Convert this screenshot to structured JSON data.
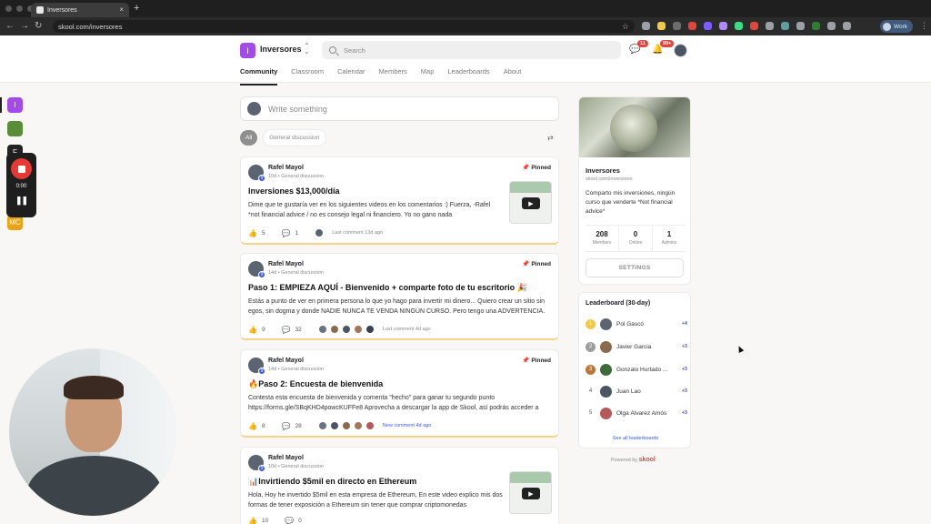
{
  "browser": {
    "tab_title": "Inversores",
    "tab_close": "×",
    "new_tab": "+",
    "back": "←",
    "forward": "→",
    "reload": "↻",
    "url": "skool.com/inversores",
    "star": "☆",
    "profile_label": "Work",
    "menu": "⋮"
  },
  "header": {
    "group_initial": "I",
    "group_name": "Inversores",
    "search_placeholder": "Search",
    "chat_badge": "11",
    "notif_badge": "99+",
    "tabs": [
      "Community",
      "Classroom",
      "Calendar",
      "Members",
      "Map",
      "Leaderboards",
      "About"
    ]
  },
  "rail": {
    "items": [
      {
        "initial": "I",
        "color": "#a24be6"
      },
      {
        "initial": "",
        "color": "#5b8c3a"
      },
      {
        "initial": "F",
        "color": "#222222"
      },
      {
        "initial": "MC",
        "color": "#e8a317"
      }
    ],
    "recorder_time": "0:00"
  },
  "composer": {
    "placeholder": "Write something"
  },
  "filters": {
    "all": "All",
    "general": "General discussion",
    "filter_icon": "⇄"
  },
  "posts": [
    {
      "author": "Rafel Mayol",
      "level": "9",
      "meta": "10d • General discussion",
      "pinned": "Pinned",
      "title": "Inversiones $13,000/día",
      "body": "Dime que te gustaría ver en los siguientes videos en los comentarios :) Fuerza, -Rafel *not financial advice / no es consejo legal ni financiero. Yo no gano nada",
      "likes": "5",
      "comments": "1",
      "last": "Last comment 13d ago"
    },
    {
      "author": "Rafel Mayol",
      "level": "9",
      "meta": "14d • General discussion",
      "pinned": "Pinned",
      "title": "Paso 1: EMPIEZA AQUÍ - Bienvenido + comparte foto de tu escritorio 🎉",
      "body": "Estás a punto de ver en primera persona lo que yo hago para invertir mi dinero... Quiero crear un sitio sin egos, sin dogma y donde NADIE NUNCA TE VENDA NINGÚN CURSO. Pero tengo una ADVERTENCIA.",
      "likes": "9",
      "comments": "32",
      "last": "Last comment 4d ago"
    },
    {
      "author": "Rafel Mayol",
      "level": "9",
      "meta": "14d • General discussion",
      "pinned": "Pinned",
      "title": "🔥Paso 2: Encuesta de bienvenida",
      "body": "Contesta esta encuesta de bienvenida y comenta \"hecho\" para ganar tu segundo punto https://forms.gle/SBqKHD4powcKUFFe8 Aprovecha a descargar la app de Skool, así podrás acceder a",
      "likes": "8",
      "comments": "28",
      "last": "New comment 4d ago"
    },
    {
      "author": "Rafel Mayol",
      "level": "9",
      "meta": "10d • General discussion",
      "pinned": "",
      "title": "📊Invirtiendo $5mil en directo en Ethereum",
      "body": "Hola, Hoy he invertido $5mil en esta empresa de Ethereum, En este video explico mis dos formas de tener exposición a Ethereum sin tener que comprar criptomonedas",
      "likes": "10",
      "comments": "0",
      "last": ""
    }
  ],
  "about": {
    "name": "Inversores",
    "url": "skool.com/inversores",
    "description": "Comparto mis inversiones, ningún curso que venderte *Not financial advice*",
    "members": "208",
    "members_label": "Members",
    "online": "0",
    "online_label": "Online",
    "admins": "1",
    "admins_label": "Admins",
    "settings_label": "SETTINGS"
  },
  "leaderboard": {
    "title": "Leaderboard (30-day)",
    "rows": [
      {
        "rank": "1",
        "name": "Pol Gascó",
        "points": "+4"
      },
      {
        "rank": "2",
        "name": "Javier Garcia",
        "points": "+3"
      },
      {
        "rank": "3",
        "name": "Gonzalo Hurtado ...",
        "points": "+3"
      },
      {
        "rank": "4",
        "name": "Juan Lao",
        "points": "+3"
      },
      {
        "rank": "5",
        "name": "Olga Álvarez Amós",
        "points": "+3"
      }
    ],
    "see_all": "See all leaderboards"
  },
  "footer": {
    "powered_by": "Powered by",
    "brand": "skool"
  },
  "icons": {
    "like": "👍",
    "comment": "💬",
    "pin": "📌",
    "play": "▶",
    "chat": "💬",
    "bell": "🔔",
    "pause": "❚❚"
  }
}
